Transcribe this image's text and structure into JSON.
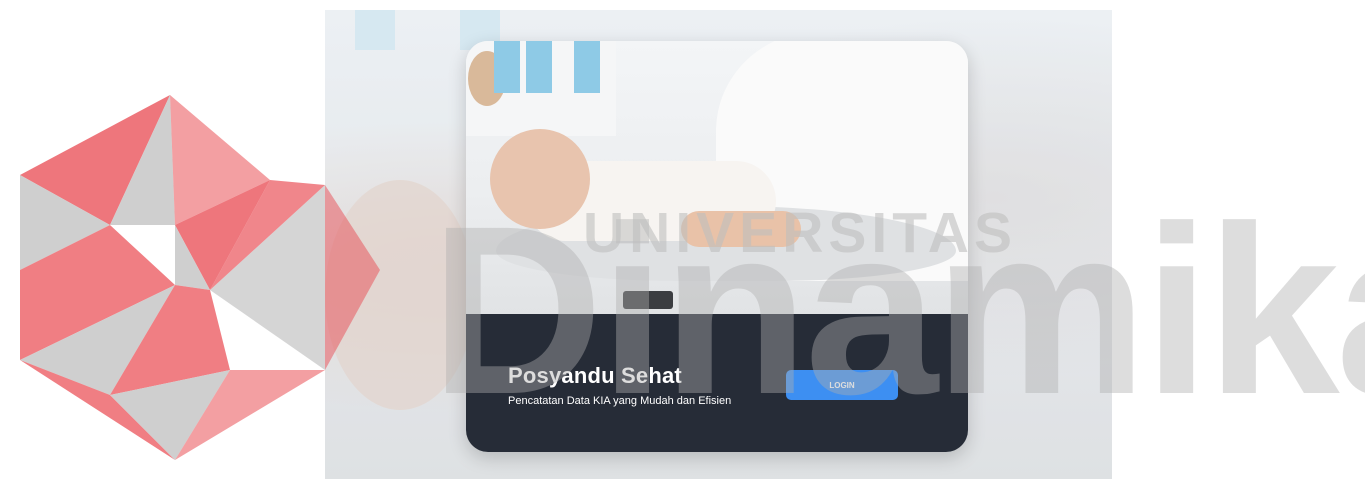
{
  "app": {
    "title": "Posyandu Sehat",
    "subtitle": "Pencatatan Data KIA yang Mudah dan Efisien"
  },
  "actions": {
    "login_label": "LOGIN"
  },
  "watermark": {
    "top_text": "UNIVERSITAS",
    "main_text": "Dinamika"
  },
  "colors": {
    "card_footer": "#262c37",
    "login_button": "#3d8ff2",
    "watermark_red": "#e8424a",
    "watermark_gray": "#bdbdbd"
  }
}
